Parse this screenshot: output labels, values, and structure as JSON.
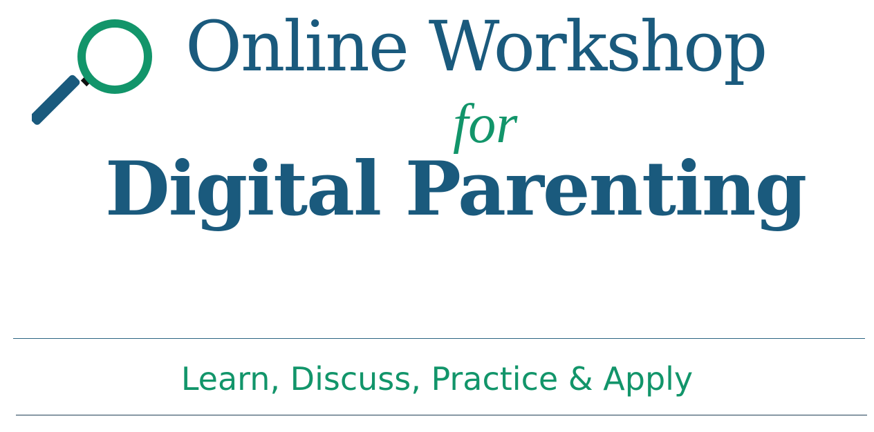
{
  "logo": {
    "icon": "magnifying-glass-icon",
    "colors": {
      "lens_ring": "#12956a",
      "handle": "#1a5a7d",
      "connector": "#111111"
    }
  },
  "title": {
    "line1": "Online Workshop",
    "connector": "for",
    "line2": "Digital Parenting"
  },
  "tagline": "Learn, Discuss, Practice & Apply",
  "colors": {
    "primary_blue": "#1a5a7d",
    "accent_green": "#12956a",
    "rule": "#2c6482",
    "background": "#ffffff"
  }
}
